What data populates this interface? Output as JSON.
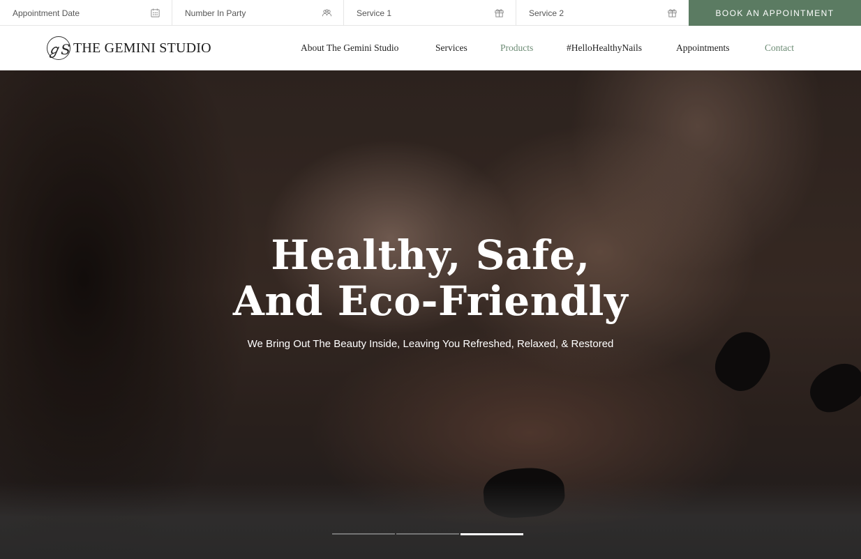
{
  "booking_bar": {
    "fields": [
      {
        "label": "Appointment Date",
        "icon": "calendar-icon"
      },
      {
        "label": "Number In Party",
        "icon": "people-icon"
      },
      {
        "label": "Service 1",
        "icon": "gift-icon"
      },
      {
        "label": "Service 2",
        "icon": "gift-icon"
      }
    ],
    "book_button": "BOOK AN APPOINTMENT",
    "accent_color": "#5b7b62"
  },
  "nav": {
    "logo_mark": "ℊS",
    "logo_text": "THE GEMINI STUDIO",
    "items": [
      {
        "label": "About The Gemini Studio"
      },
      {
        "label": "Services"
      },
      {
        "label": "Products"
      },
      {
        "label": "#HelloHealthyNails"
      },
      {
        "label": "Appointments"
      },
      {
        "label": "Contact"
      }
    ],
    "highlight_color": "#6c8b74"
  },
  "hero": {
    "title_line1": "Healthy, Safe,",
    "title_line2": "And Eco-Friendly",
    "subtitle": "We Bring Out The Beauty Inside, Leaving You Refreshed, Relaxed, & Restored",
    "slides_total": 3,
    "active_slide": 3
  }
}
